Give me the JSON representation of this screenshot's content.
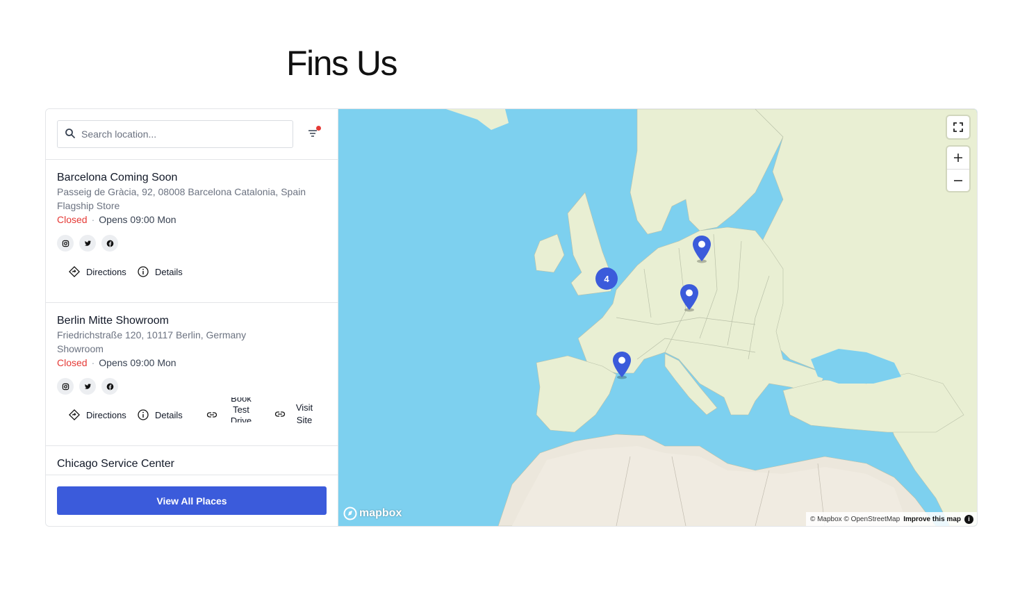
{
  "page": {
    "title": "Fins Us"
  },
  "search": {
    "placeholder": "Search location..."
  },
  "locations": [
    {
      "name": "Barcelona Coming Soon",
      "address": "Passeig de Gràcia, 92, 08008 Barcelona Catalonia, Spain",
      "type": "Flagship Store",
      "status": "Closed",
      "hours": "Opens 09:00 Mon",
      "actions": {
        "directions": "Directions",
        "details": "Details"
      }
    },
    {
      "name": "Berlin Mitte Showroom",
      "address": "Friedrichstraße 120, 10117 Berlin, Germany",
      "type": "Showroom",
      "status": "Closed",
      "hours": "Opens 09:00 Mon",
      "actions": {
        "directions": "Directions",
        "details": "Details",
        "book": [
          "Book",
          "Test",
          "Drive"
        ],
        "visit": [
          "Visit",
          "Site"
        ]
      }
    },
    {
      "name": "Chicago Service Center"
    }
  ],
  "separator": "·",
  "social_icons": [
    "instagram-icon",
    "twitter-icon",
    "facebook-icon"
  ],
  "view_all_label": "View All Places",
  "map": {
    "cluster_count": "4",
    "logo": "mapbox",
    "attribution": "© Mapbox © OpenStreetMap",
    "improve": "Improve this map",
    "info": "i"
  },
  "colors": {
    "accent": "#3b5bdb",
    "closed": "#e53935",
    "water": "#7dd0ef",
    "land": "#e9efd3"
  }
}
